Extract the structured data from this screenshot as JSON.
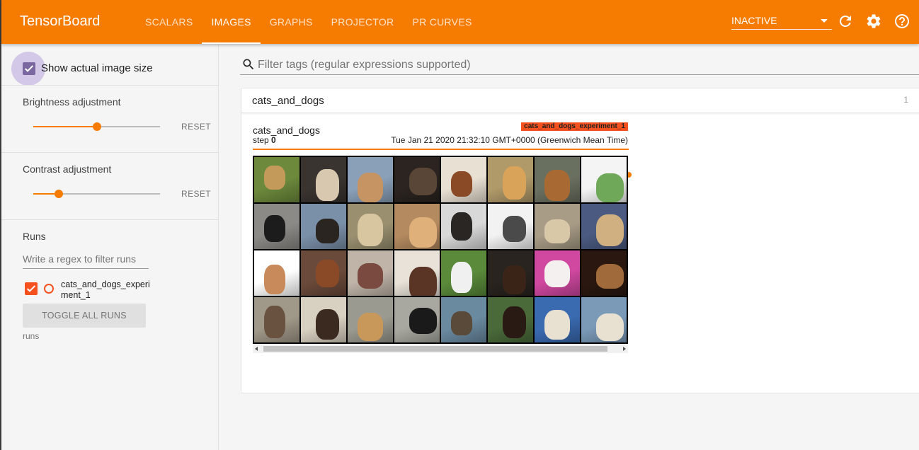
{
  "app": {
    "title": "TensorBoard"
  },
  "nav": {
    "tabs": [
      {
        "label": "SCALARS",
        "active": false
      },
      {
        "label": "IMAGES",
        "active": true
      },
      {
        "label": "GRAPHS",
        "active": false
      },
      {
        "label": "PROJECTOR",
        "active": false
      },
      {
        "label": "PR CURVES",
        "active": false
      }
    ],
    "status": "INACTIVE",
    "icons": [
      "refresh-icon",
      "settings-icon",
      "help-icon"
    ]
  },
  "sidebar": {
    "show_actual_size": {
      "label": "Show actual image size",
      "checked": true
    },
    "brightness": {
      "label": "Brightness adjustment",
      "value": 0.5,
      "reset": "RESET"
    },
    "contrast": {
      "label": "Contrast adjustment",
      "value": 0.2,
      "reset": "RESET"
    },
    "runs": {
      "title": "Runs",
      "filter_placeholder": "Write a regex to filter runs",
      "items": [
        {
          "name": "cats_and_dogs_experiment_1",
          "checked": true
        }
      ],
      "toggle_all": "TOGGLE ALL RUNS",
      "footer": "runs"
    }
  },
  "main": {
    "search_placeholder": "Filter tags (regular expressions supported)",
    "category": {
      "name": "cats_and_dogs",
      "count": "1"
    },
    "image_card": {
      "tag": "cats_and_dogs",
      "run": "cats_and_dogs_experiment_1",
      "step_label": "step",
      "step": "0",
      "timestamp": "Tue Jan 21 2020 21:32:10 GMT+0000 (Greenwich Mean Time)",
      "step_progress": 1.0
    }
  },
  "colors": {
    "accent": "#f57c00",
    "run": "#f4511e",
    "checkbox": "#7b68a0"
  }
}
